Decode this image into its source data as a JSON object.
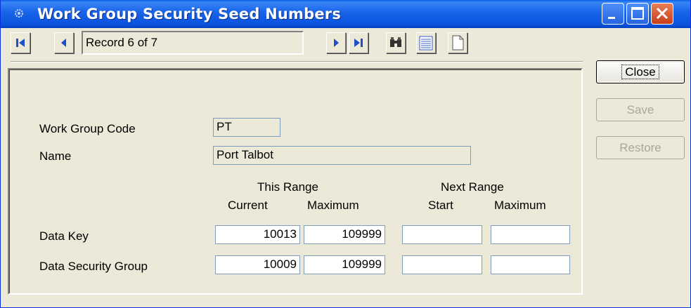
{
  "window": {
    "title": "Work Group Security Seed Numbers",
    "icon": "gear-icon",
    "accent": "#0a52dd"
  },
  "navigation": {
    "record_text": "Record 6 of 7",
    "first_icon": "first-record-icon",
    "prev_icon": "prev-record-icon",
    "next_icon": "next-record-icon",
    "last_icon": "last-record-icon",
    "find_icon": "binoculars-icon",
    "list_icon": "list-icon",
    "new_icon": "new-document-icon"
  },
  "buttons": {
    "close": "Close",
    "save": "Save",
    "restore": "Restore"
  },
  "form": {
    "work_group_code_label": "Work Group Code",
    "work_group_code_value": "PT",
    "name_label": "Name",
    "name_value": "Port Talbot",
    "this_range_header": "This Range",
    "next_range_header": "Next Range",
    "col_current": "Current",
    "col_maximum": "Maximum",
    "col_start": "Start",
    "col_next_maximum": "Maximum",
    "rows": [
      {
        "label": "Data Key",
        "current": "10013",
        "maximum": "109999",
        "start": "",
        "next_maximum": ""
      },
      {
        "label": "Data Security Group",
        "current": "10009",
        "maximum": "109999",
        "start": "",
        "next_maximum": ""
      }
    ]
  }
}
